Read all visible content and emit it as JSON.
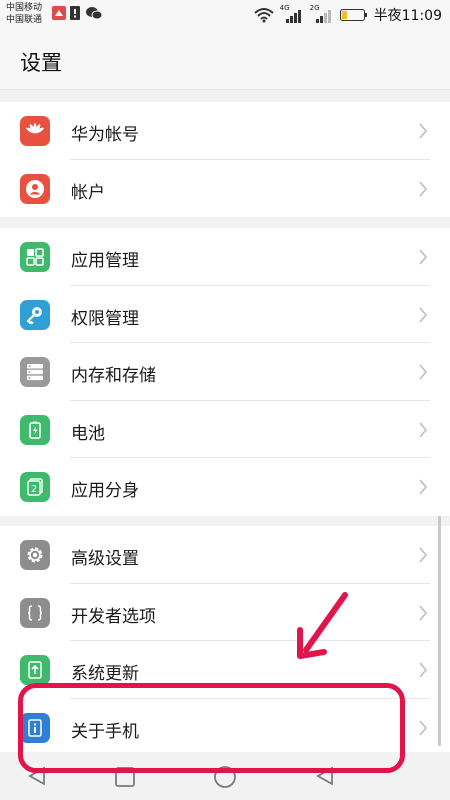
{
  "status_bar": {
    "carrier1": "中国移动",
    "carrier2": "中国联通",
    "net1": "4G",
    "net2": "2G",
    "time": "半夜11:09"
  },
  "header": {
    "title": "设置"
  },
  "sections": [
    {
      "items": [
        {
          "label": "华为帐号",
          "icon": "huawei-logo-icon",
          "color": "#e8513f"
        },
        {
          "label": "帐户",
          "icon": "user-icon",
          "color": "#e8513f"
        }
      ]
    },
    {
      "items": [
        {
          "label": "应用管理",
          "icon": "apps-grid-icon",
          "color": "#3fba6c"
        },
        {
          "label": "权限管理",
          "icon": "key-icon",
          "color": "#2f9fd6"
        },
        {
          "label": "内存和存储",
          "icon": "storage-icon",
          "color": "#9a9a9a"
        },
        {
          "label": "电池",
          "icon": "battery-icon",
          "color": "#3fba6c"
        },
        {
          "label": "应用分身",
          "icon": "app-twin-icon",
          "color": "#3fba6c"
        }
      ]
    },
    {
      "items": [
        {
          "label": "高级设置",
          "icon": "gear-icon",
          "color": "#8d8d8d"
        },
        {
          "label": "开发者选项",
          "icon": "braces-icon",
          "color": "#8d8d8d"
        },
        {
          "label": "系统更新",
          "icon": "system-update-icon",
          "color": "#3fba6c"
        },
        {
          "label": "关于手机",
          "icon": "info-icon",
          "color": "#2f7fd6"
        }
      ]
    }
  ],
  "annotation": {
    "color": "#e1154c"
  }
}
